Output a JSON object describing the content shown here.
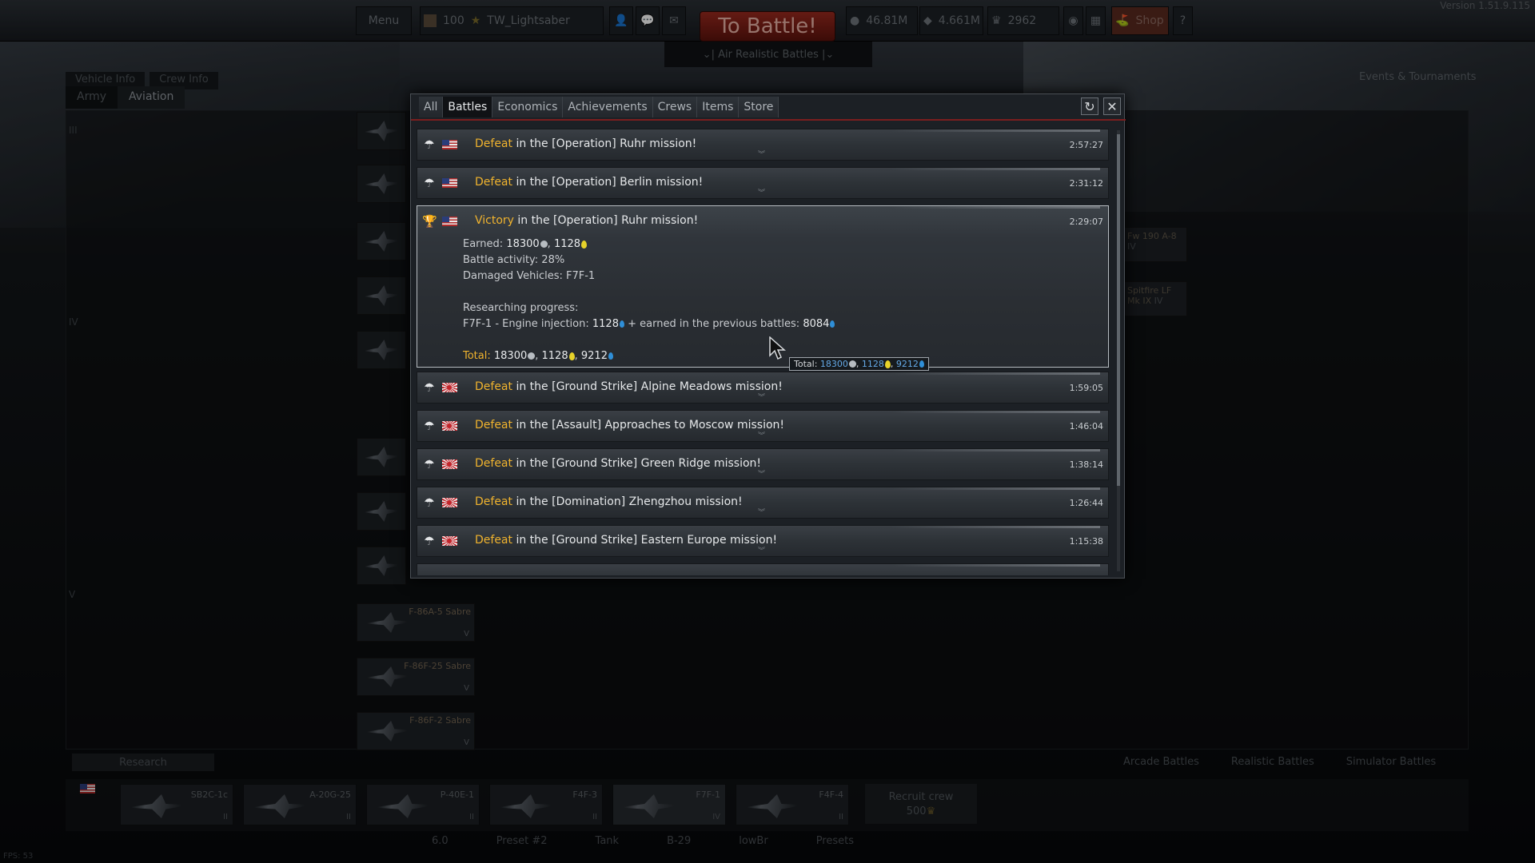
{
  "topbar": {
    "menu_label": "Menu",
    "level": "100",
    "player_name": "TW_Lightsaber",
    "battle_button": "To Battle!",
    "mode": "⌄| Air Realistic Battles |⌄",
    "silver_lions": "46.81M",
    "research_points": "4.661M",
    "golden_eagles": "2962",
    "shop_label": "Shop",
    "help_label": "?",
    "version": "Version 1.51.9.115"
  },
  "hangar": {
    "vehicle_info_tab": "Vehicle Info",
    "crew_info_tab": "Crew Info",
    "army_tab": "Army",
    "aviation_tab": "Aviation",
    "events_label": "Events & Tournaments",
    "ranks": [
      "III",
      "IV",
      "V"
    ],
    "tree_cards": [
      {
        "name": "F-86A-5 Sabre",
        "rank": "V"
      },
      {
        "name": "F-86F-25 Sabre",
        "rank": "V"
      },
      {
        "name": "F-86F-2 Sabre",
        "rank": "V"
      }
    ],
    "side_cards": [
      {
        "name": "Fw 190 A-8",
        "rank": "IV"
      },
      {
        "name": "Spitfire LF Mk IX",
        "rank": "IV"
      }
    ],
    "research_label": "Research",
    "battle_modes": [
      "Arcade Battles",
      "Realistic Battles",
      "Simulator Battles"
    ],
    "crew_slots": [
      {
        "name": "SB2C-1c",
        "rank": "II"
      },
      {
        "name": "A-20G-25",
        "rank": "II"
      },
      {
        "name": "P-40E-1",
        "rank": "II"
      },
      {
        "name": "F4F-3",
        "rank": "II"
      },
      {
        "name": "F7F-1",
        "rank": "IV"
      },
      {
        "name": "F4F-4",
        "rank": "II"
      }
    ],
    "recruit_label": "Recruit crew",
    "recruit_cost": "500",
    "bottom_bar": [
      "6.0",
      "Preset #2",
      "Tank",
      "B-29",
      "lowBr",
      "Presets"
    ],
    "fps": "FPS: 53"
  },
  "popup": {
    "tabs": [
      "All",
      "Battles",
      "Economics",
      "Achievements",
      "Crews",
      "Items",
      "Store"
    ],
    "active_tab": "Battles",
    "entries": [
      {
        "result": "Defeat",
        "text": " in the [Operation] Ruhr mission!",
        "time": "2:57:27",
        "flag": "us"
      },
      {
        "result": "Defeat",
        "text": " in the [Operation] Berlin mission!",
        "time": "2:31:12",
        "flag": "us"
      },
      {
        "result": "Victory",
        "text": " in the [Operation] Ruhr mission!",
        "time": "2:29:07",
        "flag": "us"
      },
      {
        "result": "Defeat",
        "text": " in the [Ground Strike] Alpine Meadows mission!",
        "time": "1:59:05",
        "flag": "jp"
      },
      {
        "result": "Defeat",
        "text": " in the [Assault] Approaches to Moscow mission!",
        "time": "1:46:04",
        "flag": "jp"
      },
      {
        "result": "Defeat",
        "text": " in the [Ground Strike] Green Ridge mission!",
        "time": "1:38:14",
        "flag": "jp"
      },
      {
        "result": "Defeat",
        "text": " in the [Domination] Zhengzhou mission!",
        "time": "1:26:44",
        "flag": "jp"
      },
      {
        "result": "Defeat",
        "text": " in the [Ground Strike] Eastern Europe  mission!",
        "time": "1:15:38",
        "flag": "jp"
      }
    ],
    "detail": {
      "earned_label": "Earned:",
      "earned_sl": "18300",
      "earned_rp": "1128",
      "activity": "Battle activity: 28%",
      "damaged": "Damaged Vehicles: F7F-1",
      "research_label": "Researching progress:",
      "research_prefix": "F7F-1 - Engine injection:",
      "research_rp": "1128",
      "research_mid": "+ earned in the previous battles:",
      "research_prev": "8084",
      "total_label": "Total:",
      "total_sl": "18300",
      "total_rp": "1128",
      "total_crp": "9212"
    },
    "tooltip": {
      "label": "Total:",
      "sl": "18300",
      "rp": "1128",
      "crp": "9212"
    }
  }
}
